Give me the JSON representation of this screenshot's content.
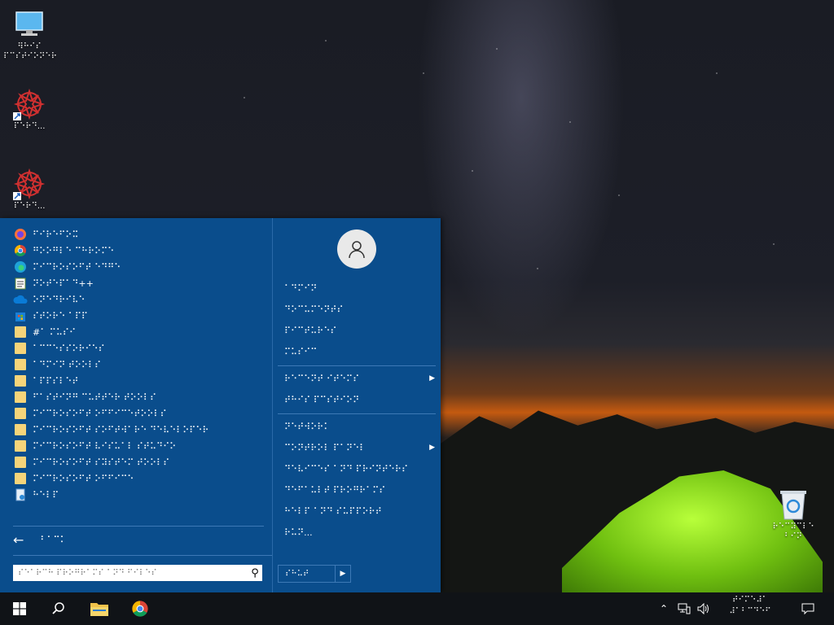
{
  "desktop": {
    "icons": [
      {
        "name": "this-pc",
        "label": "⠻⠓⠊⠎\n⠏⠉⠎⠞⠊⠕⠝⠑⠗"
      },
      {
        "name": "shortcut-1",
        "label": "⠏⠑⠗⠙..."
      },
      {
        "name": "shortcut-2",
        "label": "⠏⠑⠗⠙..."
      },
      {
        "name": "recycle-bin",
        "label": "⠗⠑⠉⠽⠉⠇⠑\n⠃⠊⠝"
      }
    ]
  },
  "start_menu": {
    "apps": [
      {
        "icon": "firefox-icon",
        "label": "⠋⠊⠗⠑⠋⠕⠭"
      },
      {
        "icon": "chrome-icon",
        "label": "⠛⠕⠕⠛⠇⠑ ⠉⠓⠗⠕⠍⠑"
      },
      {
        "icon": "edge-icon",
        "label": "⠍⠊⠉⠗⠕⠎⠕⠋⠞ ⠑⠙⠛⠑"
      },
      {
        "icon": "notepad-icon",
        "label": "⠝⠕⠞⠑⠏⠁⠙++"
      },
      {
        "icon": "onedrive-icon",
        "label": "⠕⠝⠑⠙⠗⠊⠧⠑"
      },
      {
        "icon": "store-icon",
        "label": "⠎⠞⠕⠗⠑ ⠁⠏⠏"
      },
      {
        "icon": "folder-icon",
        "label": "#⠁ ⠍⠥⠎⠊"
      },
      {
        "icon": "folder-icon",
        "label": "⠁⠉⠉⠑⠎⠎⠕⠗⠊⠑⠎"
      },
      {
        "icon": "folder-icon",
        "label": "⠁⠙⠍⠊⠝ ⠞⠕⠕⠇⠎"
      },
      {
        "icon": "folder-icon",
        "label": "⠁⠏⠏⠎⠇⠑⠞"
      },
      {
        "icon": "folder-icon",
        "label": "⠋⠁⠎⠞⠊⠝⠛ ⠉⠥⠞⠞⠑⠗ ⠞⠕⠕⠇⠎"
      },
      {
        "icon": "folder-icon",
        "label": "⠍⠊⠉⠗⠕⠎⠕⠋⠞ ⠕⠋⠋⠊⠉⠑⠞⠕⠕⠇⠎"
      },
      {
        "icon": "folder-icon",
        "label": "⠍⠊⠉⠗⠕⠎⠕⠋⠞ ⠎⠕⠋⠞⠺⠁⠗⠑ ⠙⠑⠧⠑⠇⠕⠏⠑⠗"
      },
      {
        "icon": "folder-icon",
        "label": "⠍⠊⠉⠗⠕⠎⠕⠋⠞ ⠧⠊⠎⠥⠁⠇ ⠎⠞⠥⠙⠊⠕"
      },
      {
        "icon": "folder-icon",
        "label": "⠍⠊⠉⠗⠕⠎⠕⠋⠞ ⠎⠽⠎⠞⠑⠍ ⠞⠕⠕⠇⠎"
      },
      {
        "icon": "folder-icon",
        "label": "⠍⠊⠉⠗⠕⠎⠕⠋⠞ ⠕⠋⠋⠊⠉⠑"
      },
      {
        "icon": "help-icon",
        "label": "⠓⠑⠇⠏"
      }
    ],
    "back_label": "⠃⠁⠉⠅",
    "search_placeholder": "⠎⠑⠁⠗⠉⠓ ⠏⠗⠕⠛⠗⠁⠍⠎ ⠁⠝⠙ ⠋⠊⠇⠑⠎",
    "right": {
      "group1": [
        "⠁⠙⠍⠊⠝",
        "⠙⠕⠉⠥⠍⠑⠝⠞⠎",
        "⠏⠊⠉⠞⠥⠗⠑⠎",
        "⠍⠥⠎⠊⠉"
      ],
      "group2": [
        {
          "label": "⠗⠑⠉⠑⠝⠞ ⠊⠞⠑⠍⠎",
          "submenu": true
        },
        {
          "label": "⠞⠓⠊⠎ ⠏⠉⠎⠞⠊⠕⠝",
          "submenu": false
        }
      ],
      "group3": [
        {
          "label": "⠝⠑⠞⠺⠕⠗⠅",
          "submenu": false
        },
        {
          "label": "⠉⠕⠝⠞⠗⠕⠇ ⠏⠁⠝⠑⠇",
          "submenu": true
        },
        {
          "label": "⠙⠑⠧⠊⠉⠑⠎ ⠁⠝⠙ ⠏⠗⠊⠝⠞⠑⠗⠎",
          "submenu": false
        },
        {
          "label": "⠙⠑⠋⠁⠥⠇⠞ ⠏⠗⠕⠛⠗⠁⠍⠎",
          "submenu": false
        },
        {
          "label": "⠓⠑⠇⠏ ⠁⠝⠙ ⠎⠥⠏⠏⠕⠗⠞",
          "submenu": false
        },
        {
          "label": "⠗⠥⠝...",
          "submenu": false
        }
      ],
      "shutdown_label": "⠎⠓⠥⠞"
    }
  },
  "taskbar": {
    "clock_time": "⠞⠊⠍⠑⠼⠁",
    "clock_date": "⠼⠁⠃⠉⠙⠑⠋"
  }
}
